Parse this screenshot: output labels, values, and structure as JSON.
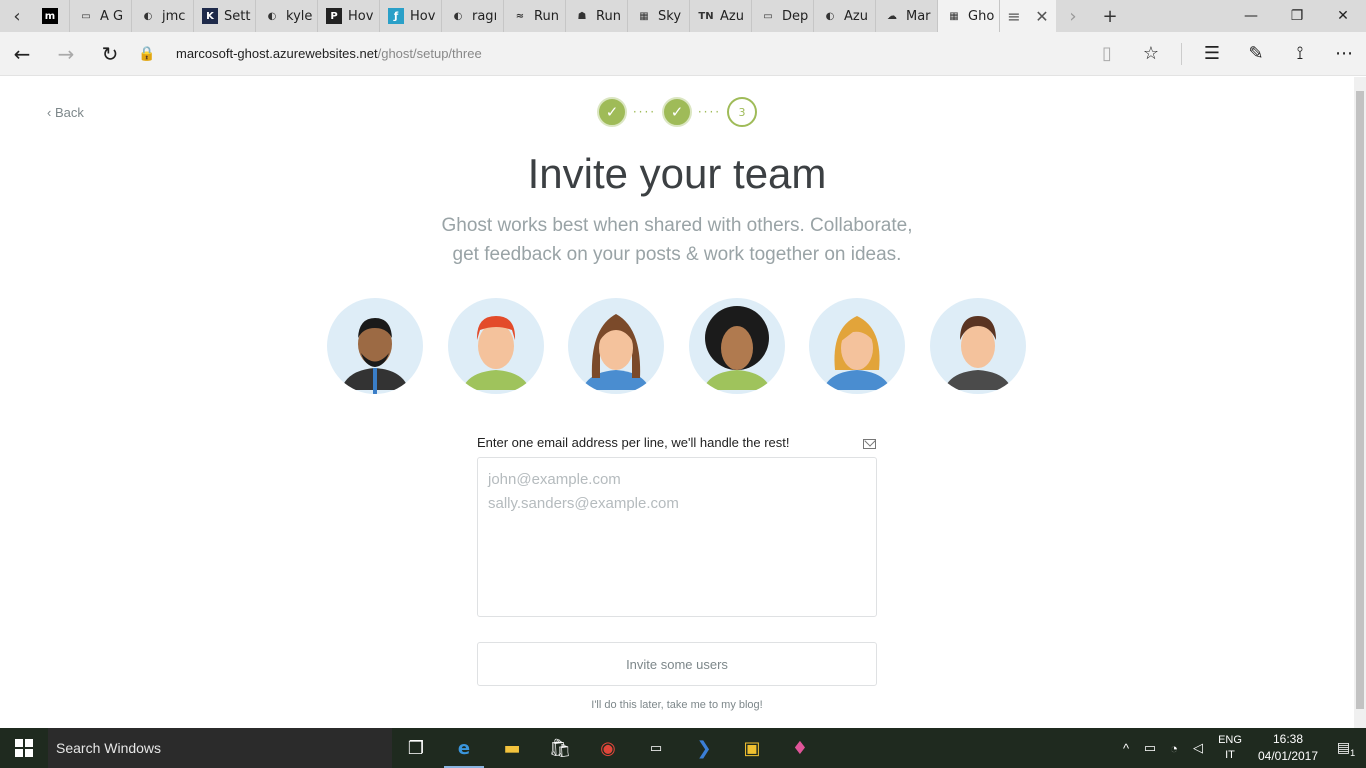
{
  "browser": {
    "tabs": [
      {
        "label": "",
        "fav": "m",
        "fav_color": "#000000",
        "icon": "medium-icon"
      },
      {
        "label": "A G",
        "fav": "▭",
        "fav_color": "transparent",
        "icon": "page-icon"
      },
      {
        "label": "jmc",
        "fav": "◐",
        "fav_color": "transparent",
        "icon": "github-icon"
      },
      {
        "label": "Sett",
        "fav": "K",
        "fav_color": "#1e2a4a",
        "icon": "kudu-icon"
      },
      {
        "label": "kyle",
        "fav": "◐",
        "fav_color": "transparent",
        "icon": "github-icon"
      },
      {
        "label": "Hov",
        "fav": "P",
        "fav_color": "#222222",
        "icon": "p-icon"
      },
      {
        "label": "Hov",
        "fav": "ƒ",
        "fav_color": "#2aa0c8",
        "icon": "f-icon"
      },
      {
        "label": "ragı",
        "fav": "◐",
        "fav_color": "transparent",
        "icon": "github-icon"
      },
      {
        "label": "Run",
        "fav": "≈",
        "fav_color": "transparent",
        "icon": "docker-icon"
      },
      {
        "label": "Run",
        "fav": "☗",
        "fav_color": "transparent",
        "icon": "robot-icon"
      },
      {
        "label": "Sky",
        "fav": "▦",
        "fav_color": "transparent",
        "icon": "microsoft-icon"
      },
      {
        "label": "Azu",
        "fav": "TN",
        "fav_color": "transparent",
        "icon": "technet-icon"
      },
      {
        "label": "Dep",
        "fav": "▭",
        "fav_color": "transparent",
        "icon": "page-icon"
      },
      {
        "label": "Azu",
        "fav": "◐",
        "fav_color": "transparent",
        "icon": "github-icon"
      },
      {
        "label": "Mar",
        "fav": "☁",
        "fav_color": "transparent",
        "icon": "cloud-icon"
      },
      {
        "label": "Gho",
        "fav": "▦",
        "fav_color": "transparent",
        "icon": "microsoft-icon"
      }
    ],
    "address_host": "marcosoft-ghost.azurewebsites.net",
    "address_path": "/ghost/setup/three"
  },
  "page": {
    "back_label": "Back",
    "step3_label": "3",
    "title": "Invite your team",
    "subtitle": "Ghost works best when shared with others. Collaborate, get feedback on your posts & work together on ideas.",
    "form_label": "Enter one email address per line, we'll handle the rest!",
    "emails_placeholder": "john@example.com\nsally.sanders@example.com",
    "invite_button": "Invite some users",
    "skip_link": "I'll do this later, take me to my blog!"
  },
  "taskbar": {
    "search_placeholder": "Search Windows",
    "lang_top": "ENG",
    "lang_bottom": "IT",
    "time": "16:38",
    "date": "04/01/2017",
    "notification_count": "1"
  },
  "colors": {
    "accent": "#9fbb58",
    "muted_text": "#99a3a6",
    "avatar_bg": "#deedf7"
  }
}
